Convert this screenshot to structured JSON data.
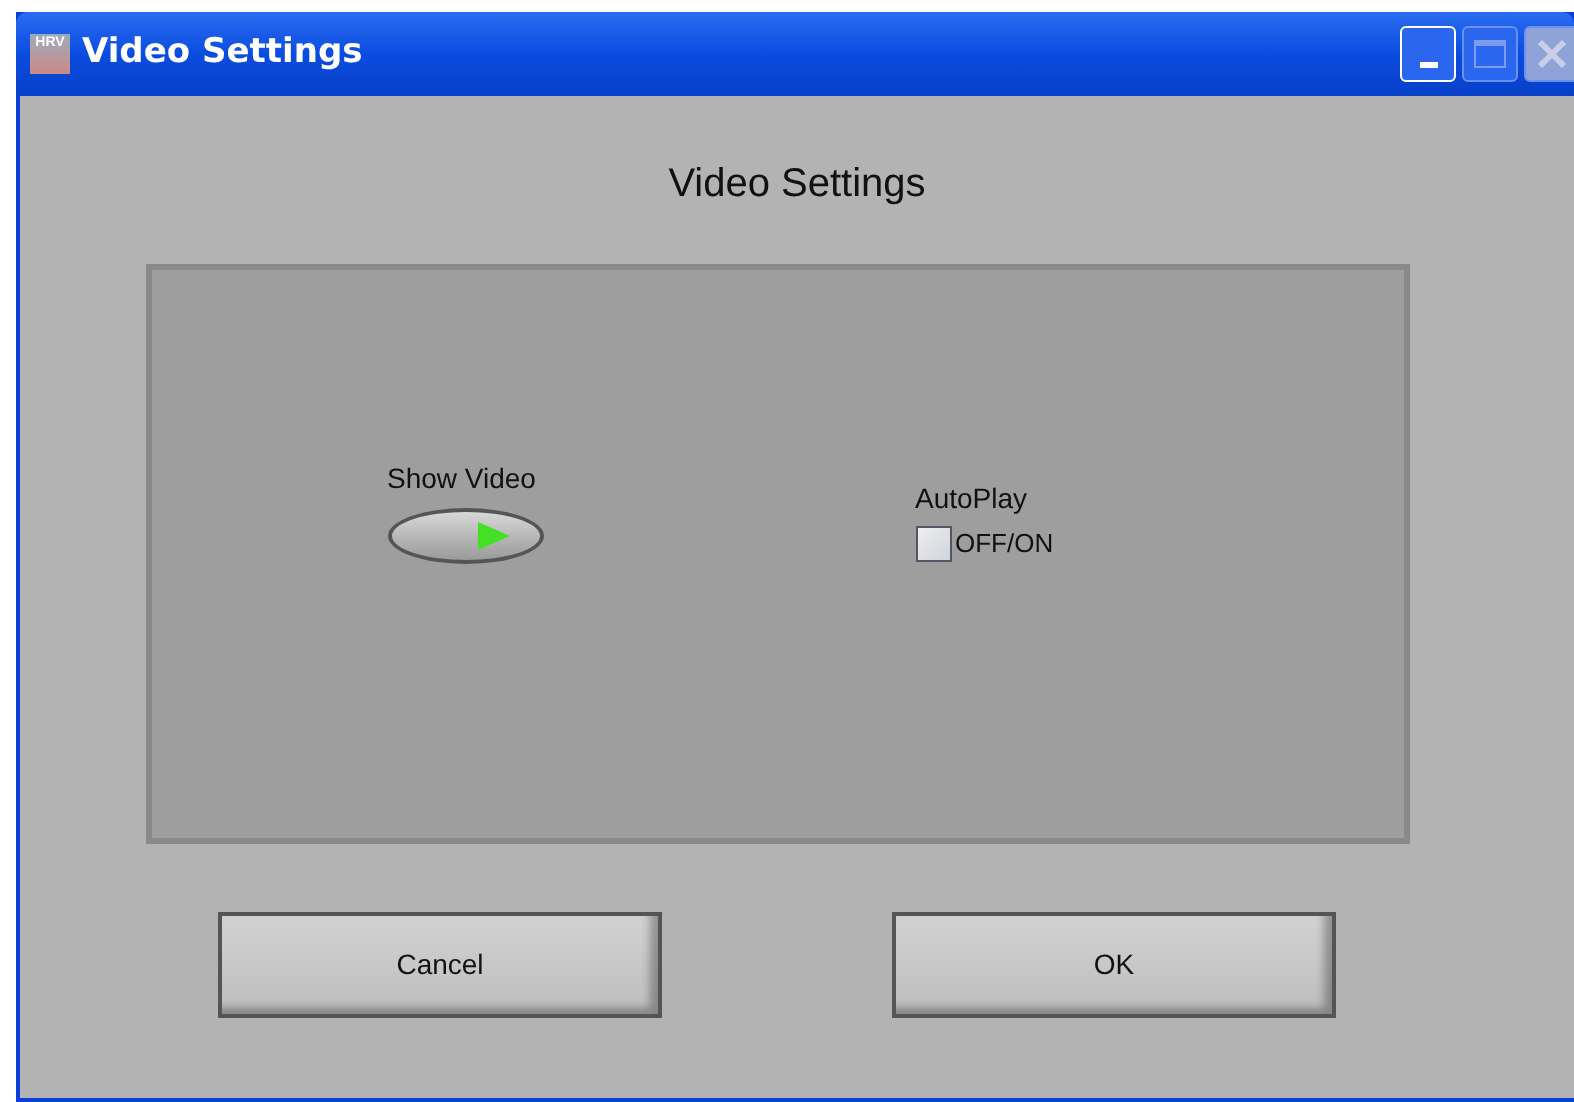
{
  "window": {
    "title": "Video Settings",
    "icon_text": "HRV"
  },
  "heading": "Video Settings",
  "controls": [
    {
      "kind": "toggle",
      "label": "Show Video",
      "on": true
    },
    {
      "kind": "checkbox",
      "label": "AutoPlay",
      "caption": "OFF/ON",
      "checked": false
    }
  ],
  "buttons": [
    "Cancel",
    "OK"
  ]
}
